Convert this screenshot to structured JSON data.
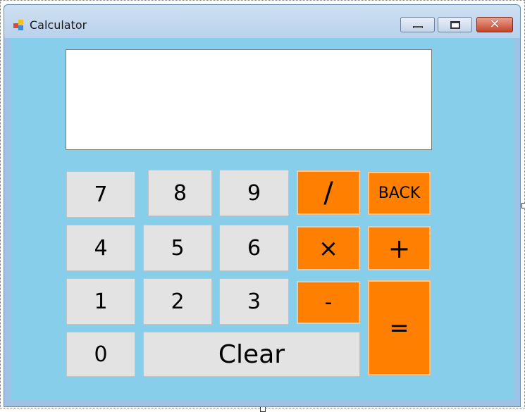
{
  "window": {
    "title": "Calculator",
    "controls": {
      "minimize": "minimize",
      "maximize": "maximize",
      "close": "close"
    }
  },
  "display": {
    "value": ""
  },
  "keys": {
    "k7": "7",
    "k8": "8",
    "k9": "9",
    "divide": "/",
    "back": "BACK",
    "k4": "4",
    "k5": "5",
    "k6": "6",
    "multiply": "×",
    "plus": "+",
    "k1": "1",
    "k2": "2",
    "k3": "3",
    "minus": "-",
    "equals": "=",
    "k0": "0",
    "clear": "Clear"
  },
  "colors": {
    "form_background": "#87ceeb",
    "number_key": "#e3e3e3",
    "operator_key": "#ff8000",
    "display": "#ffffff"
  },
  "icons": [
    "app-icon",
    "minimize-icon",
    "maximize-icon",
    "close-icon"
  ]
}
